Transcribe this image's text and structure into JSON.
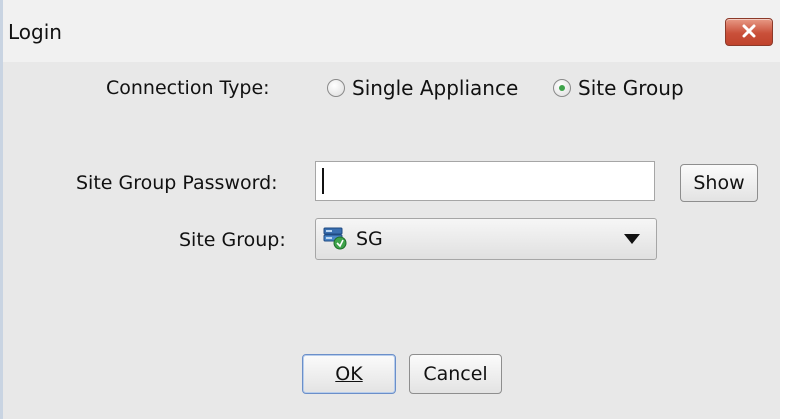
{
  "window": {
    "title": "Login"
  },
  "connection": {
    "label": "Connection Type:",
    "options": [
      {
        "label": "Single Appliance",
        "selected": false
      },
      {
        "label": "Site Group",
        "selected": true
      }
    ]
  },
  "password": {
    "label": "Site Group Password:",
    "value": "",
    "show_label": "Show"
  },
  "site_group": {
    "label": "Site Group:",
    "selected_value": "SG",
    "icon": "site-group-servers-icon"
  },
  "buttons": {
    "ok_label": "OK",
    "cancel_label": "Cancel"
  },
  "colors": {
    "background": "#e8e8e8",
    "close_button": "#c9503a",
    "radio_selected": "#3ea34a"
  }
}
